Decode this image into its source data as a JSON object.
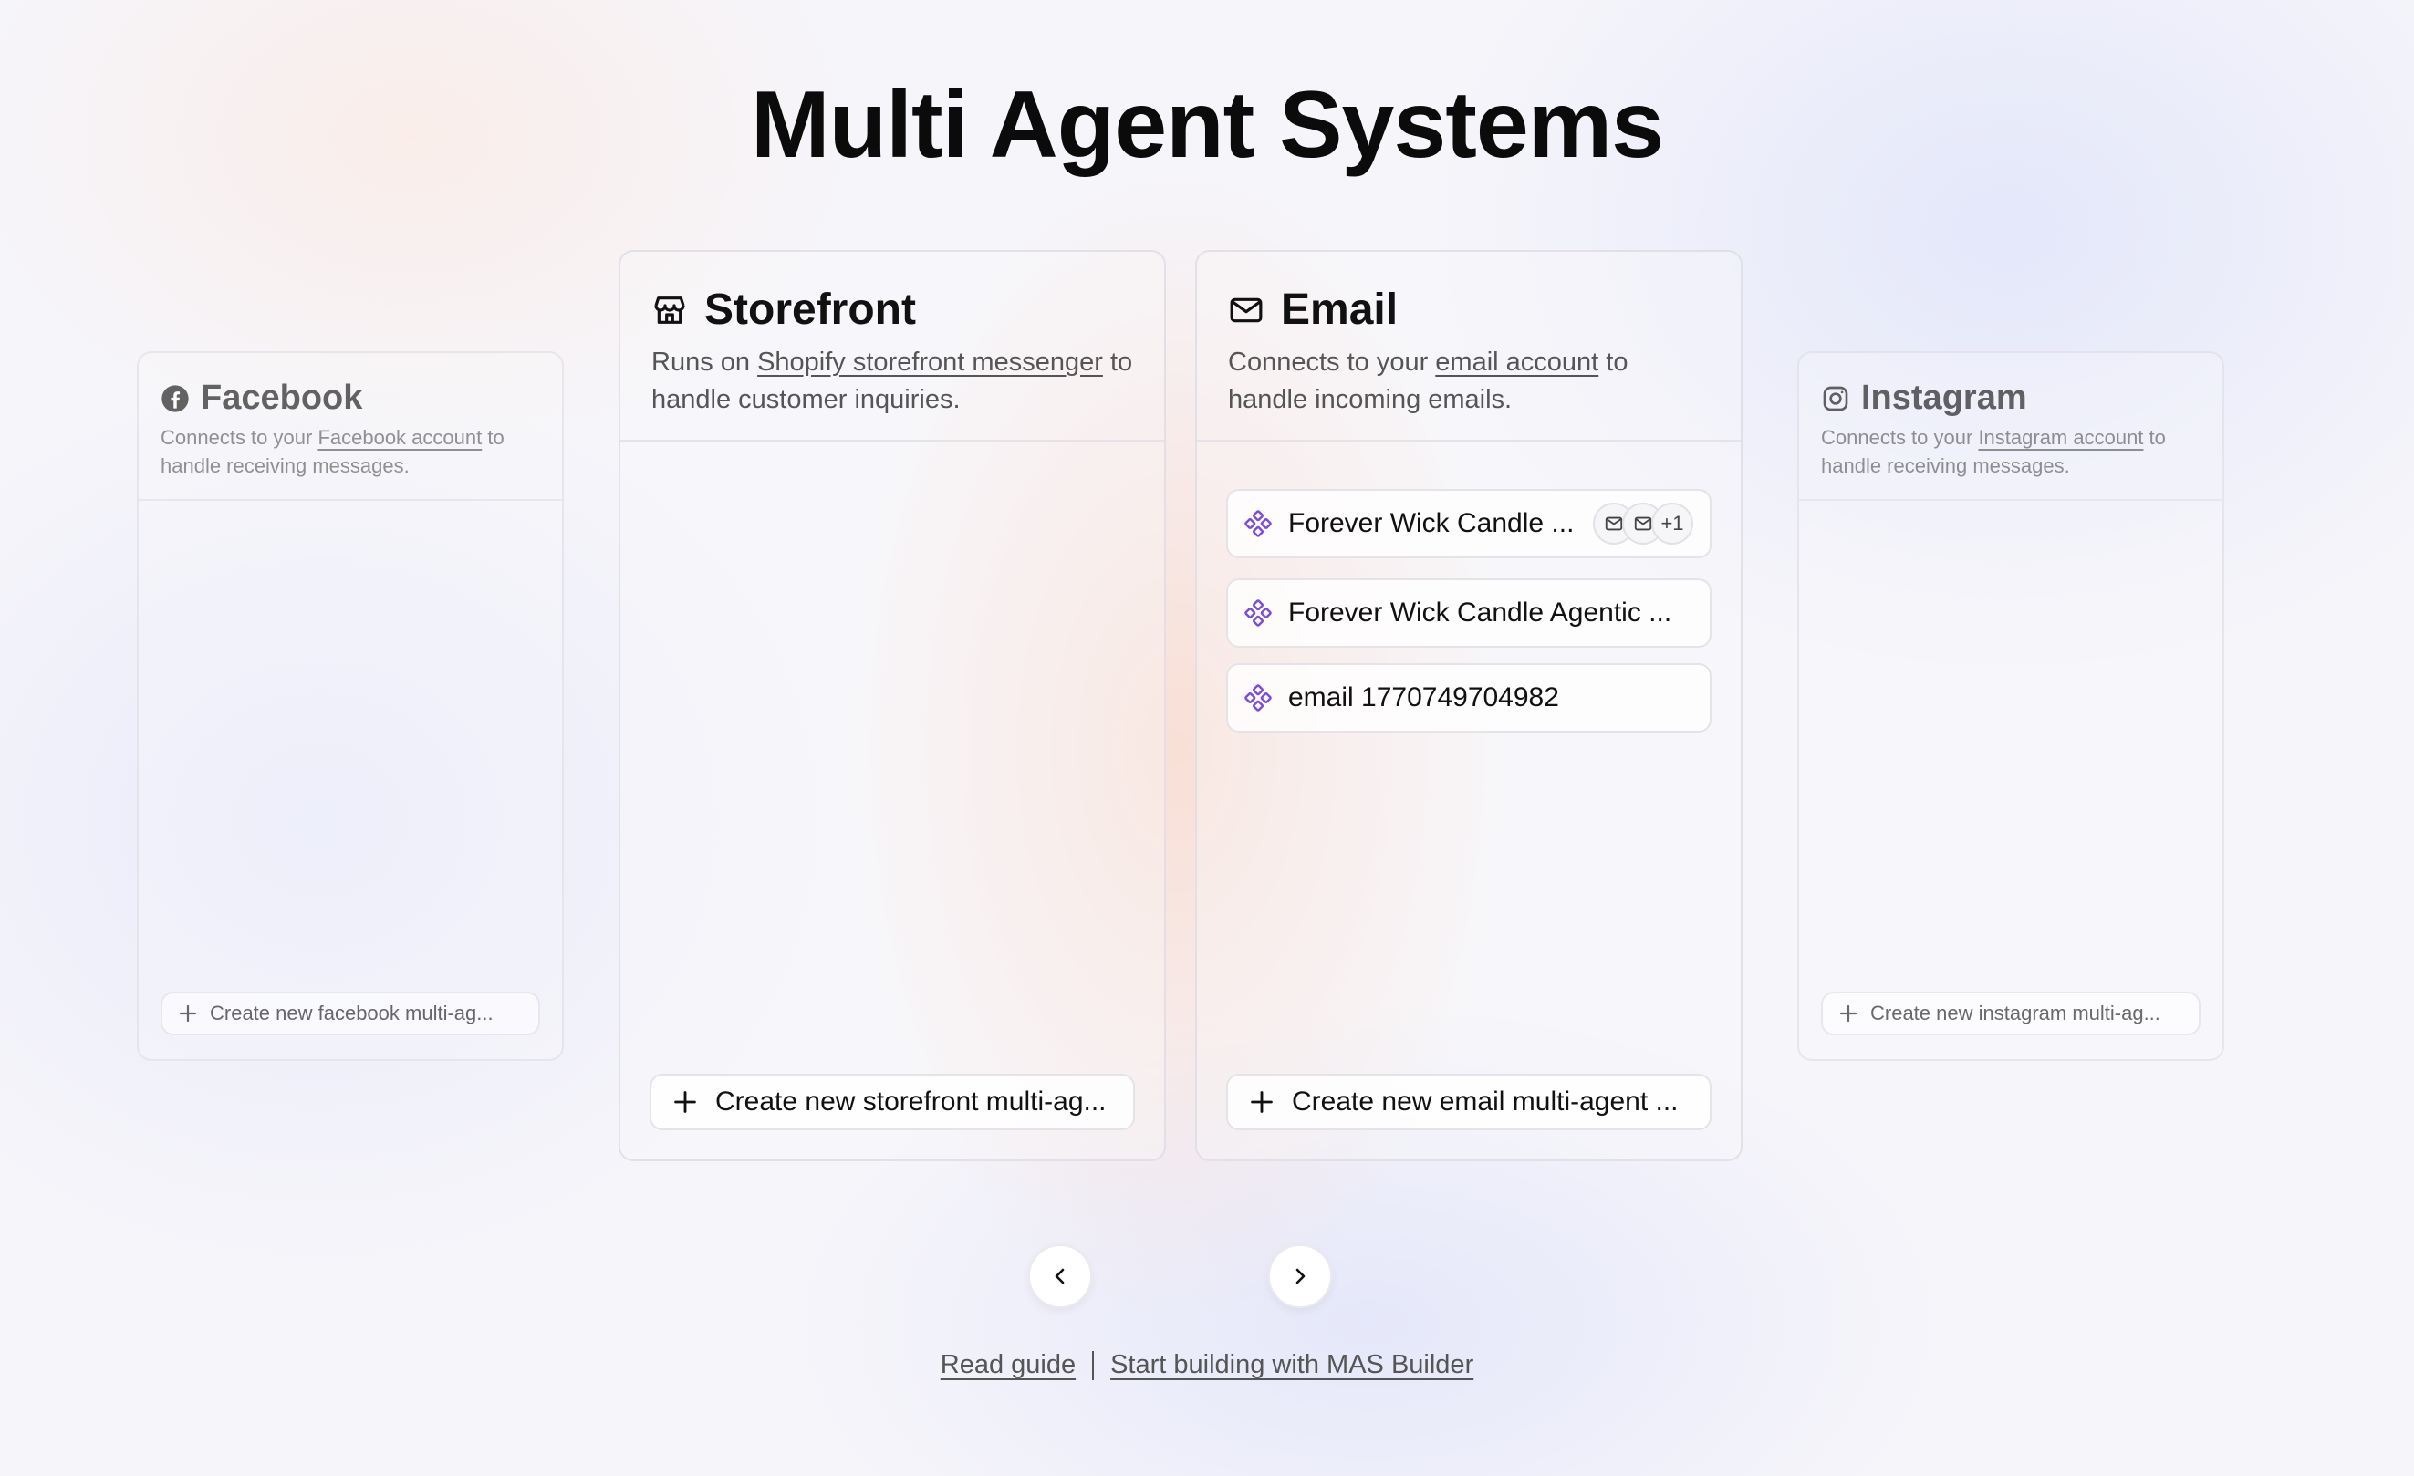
{
  "page": {
    "title": "Multi Agent Systems"
  },
  "cards": {
    "facebook": {
      "title": "Facebook",
      "desc_before": "Connects to your ",
      "desc_link": "Facebook account",
      "desc_after": " to handle receiving messages.",
      "create_label": "Create new facebook multi-ag...",
      "icon": "facebook-icon"
    },
    "storefront": {
      "title": "Storefront",
      "desc_before": "Runs on ",
      "desc_link": "Shopify storefront messenger",
      "desc_after": " to handle customer inquiries.",
      "create_label": "Create new storefront multi-ag...",
      "icon": "store-icon"
    },
    "email": {
      "title": "Email",
      "desc_before": "Connects to your ",
      "desc_link": "email account",
      "desc_after": " to handle incoming emails.",
      "create_label": "Create new email multi-agent ...",
      "icon": "mail-icon",
      "items": [
        {
          "name": "Forever Wick Candle ...",
          "extra_count": "+1"
        },
        {
          "name": "Forever Wick Candle Agentic ..."
        },
        {
          "name": "email 1770749704982"
        }
      ]
    },
    "instagram": {
      "title": "Instagram",
      "desc_before": "Connects to your ",
      "desc_link": "Instagram account",
      "desc_after": " to handle receiving messages.",
      "create_label": "Create new instagram multi-ag...",
      "icon": "instagram-icon"
    }
  },
  "colors": {
    "agent_icon": "#7c4ddb"
  },
  "footer": {
    "guide": "Read guide",
    "builder": "Start building with MAS Builder"
  }
}
